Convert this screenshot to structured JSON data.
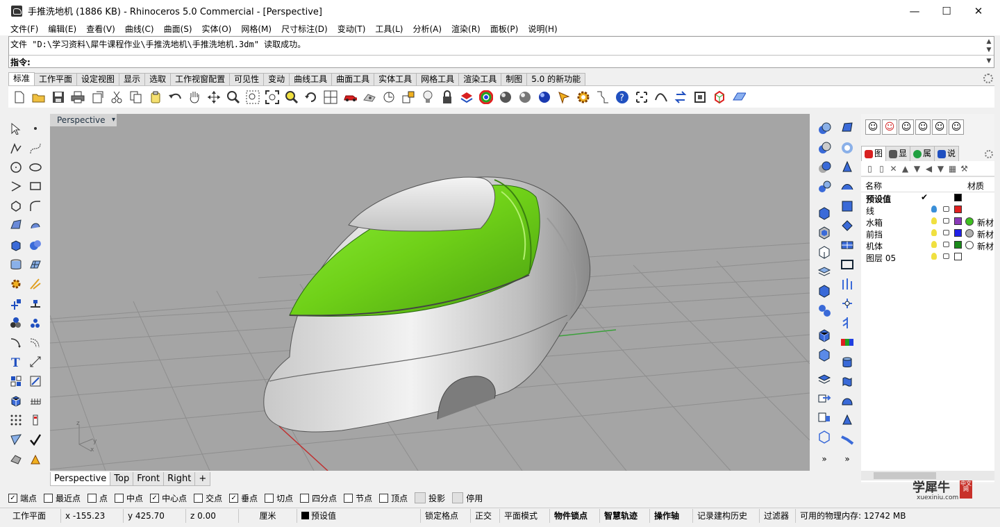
{
  "window": {
    "title": "手推洗地机 (1886 KB) - Rhinoceros 5.0 Commercial - [Perspective]",
    "minimize": "—",
    "maximize": "☐",
    "close": "✕"
  },
  "menu": [
    "文件(F)",
    "编辑(E)",
    "查看(V)",
    "曲线(C)",
    "曲面(S)",
    "实体(O)",
    "网格(M)",
    "尺寸标注(D)",
    "变动(T)",
    "工具(L)",
    "分析(A)",
    "渲染(R)",
    "面板(P)",
    "说明(H)"
  ],
  "command": {
    "history": "文件 \"D:\\学习资料\\犀牛课程作业\\手推洗地机\\手推洗地机.3dm\" 读取成功。",
    "prompt_label": "指令:",
    "value": ""
  },
  "toolbar_tabs": [
    "标准",
    "工作平面",
    "设定视图",
    "显示",
    "选取",
    "工作视窗配置",
    "可见性",
    "变动",
    "曲线工具",
    "曲面工具",
    "实体工具",
    "网格工具",
    "渲染工具",
    "制图",
    "5.0 的新功能"
  ],
  "toolbar_icons": [
    "new-file-icon",
    "open-file-icon",
    "save-icon",
    "print-icon",
    "import-icon",
    "cut-icon",
    "copy-icon",
    "paste-icon",
    "undo-icon",
    "pan-hand-icon",
    "rotate-view-icon",
    "zoom-icon",
    "zoom-window-icon",
    "zoom-extents-icon",
    "zoom-selected-icon",
    "rotate-icon",
    "four-viewports-icon",
    "car-icon",
    "camera-icon",
    "grid-snap-icon",
    "select-point-icon",
    "light-bulb-icon",
    "lock-icon",
    "layer-icon",
    "color-wheel-icon",
    "material-sphere-icon",
    "render-sphere-icon",
    "blue-sphere-icon",
    "options-icon",
    "gear-plugin-icon",
    "dimension-icon",
    "help-icon",
    "point-cloud-icon",
    "curve-tool-icon",
    "transform-icon",
    "box-edit-icon",
    "cube-color-icon",
    "plane-icon"
  ],
  "viewport": {
    "name": "Perspective",
    "axis_labels": {
      "z": "z",
      "y": "y",
      "x": "x"
    }
  },
  "viewport_tabs": [
    "Perspective",
    "Top",
    "Front",
    "Right",
    "+"
  ],
  "panel": {
    "tabs": [
      "图",
      "显",
      "属",
      "说"
    ],
    "header_name": "名称",
    "header_material": "材质",
    "layers": [
      {
        "name": "预设值",
        "bold": true,
        "current": "✔",
        "bulb": "",
        "color": "#000000",
        "material": "",
        "mat_color": ""
      },
      {
        "name": "线",
        "bold": false,
        "current": "",
        "bulb": "#3a8fd8",
        "color": "#e02020",
        "material": "",
        "mat_color": ""
      },
      {
        "name": "水箱",
        "bold": false,
        "current": "",
        "bulb": "#f0e040",
        "color": "#8a3ab8",
        "material": "新材",
        "mat_color": "#3ec020"
      },
      {
        "name": "前挡",
        "bold": false,
        "current": "",
        "bulb": "#f0e040",
        "color": "#2020e8",
        "material": "新材",
        "mat_color": "#b0b0b0"
      },
      {
        "name": "机体",
        "bold": false,
        "current": "",
        "bulb": "#f0e040",
        "color": "#1a8a1a",
        "material": "新材",
        "mat_color": "#ffffff"
      },
      {
        "name": "图层 05",
        "bold": false,
        "current": "",
        "bulb": "#f0e040",
        "color": "#ffffff",
        "material": "",
        "mat_color": ""
      }
    ]
  },
  "osnaps": [
    {
      "label": "端点",
      "checked": true
    },
    {
      "label": "最近点",
      "checked": false
    },
    {
      "label": "点",
      "checked": false
    },
    {
      "label": "中点",
      "checked": false
    },
    {
      "label": "中心点",
      "checked": true
    },
    {
      "label": "交点",
      "checked": false
    },
    {
      "label": "垂点",
      "checked": true
    },
    {
      "label": "切点",
      "checked": false
    },
    {
      "label": "四分点",
      "checked": false
    },
    {
      "label": "节点",
      "checked": false
    },
    {
      "label": "顶点",
      "checked": false
    },
    {
      "label": "投影",
      "checked": false
    },
    {
      "label": "停用",
      "checked": false
    }
  ],
  "status": {
    "cplane": "工作平面",
    "x": "x -155.23",
    "y": "y 425.70",
    "z": "z 0.00",
    "unit": "厘米",
    "layer": "预设值",
    "grid_snap": "锁定格点",
    "ortho": "正交",
    "planar": "平面模式",
    "osnap": "物件锁点",
    "smarttrack": "智慧轨迹",
    "gumball": "操作轴",
    "history": "记录建构历史",
    "filter": "过滤器",
    "memory": "可用的物理内存: 12742 MB"
  },
  "watermark": {
    "main": "学犀牛",
    "sub": "xuexiniu.com",
    "badge": "中文网"
  }
}
